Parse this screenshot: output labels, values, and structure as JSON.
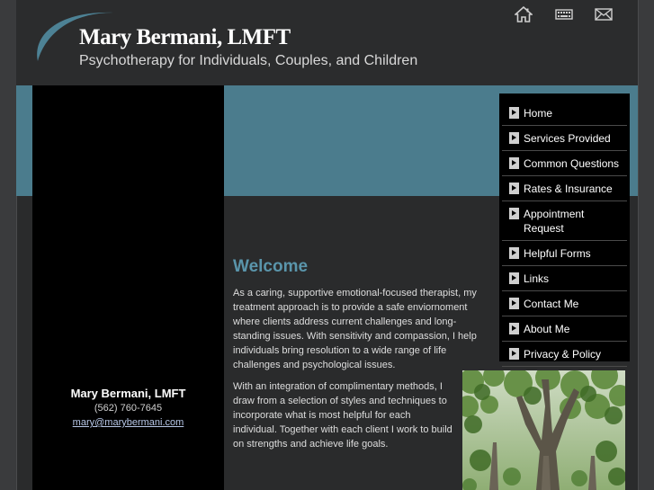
{
  "header": {
    "title": "Mary Bermani, LMFT",
    "tagline": "Psychotherapy for Individuals, Couples, and Children",
    "icons": [
      "home-icon",
      "keyboard-icon",
      "mail-icon"
    ]
  },
  "nav": {
    "items": [
      {
        "label": "Home"
      },
      {
        "label": "Services Provided"
      },
      {
        "label": "Common Questions"
      },
      {
        "label": "Rates & Insurance"
      },
      {
        "label": "Appointment Request"
      },
      {
        "label": "Helpful Forms"
      },
      {
        "label": "Links"
      },
      {
        "label": "Contact Me"
      },
      {
        "label": "About Me"
      },
      {
        "label": "Privacy & Policy"
      }
    ]
  },
  "main": {
    "welcome_title": "Welcome",
    "paragraph_1": "As a caring, supportive emotional-focused therapist, my treatment approach is to provide a safe enviornoment where clients address current challenges and long-standing issues. With sensitivity and compassion, I help individuals bring resolution to a wide range of life challenges and psychological issues.",
    "paragraph_2": "With an integration of complimentary methods, I draw from a selection of styles and techniques to incorporate what is most helpful for each individual.  Together with each client I work to build on strengths and achieve life goals."
  },
  "contact": {
    "name": "Mary Bermani, LMFT",
    "phone": "(562) 760-7645",
    "email": "mary@marybermani.com"
  },
  "colors": {
    "accent": "#4b7c8d",
    "welcome": "#5a95ab",
    "background": "#2a2b2c"
  }
}
